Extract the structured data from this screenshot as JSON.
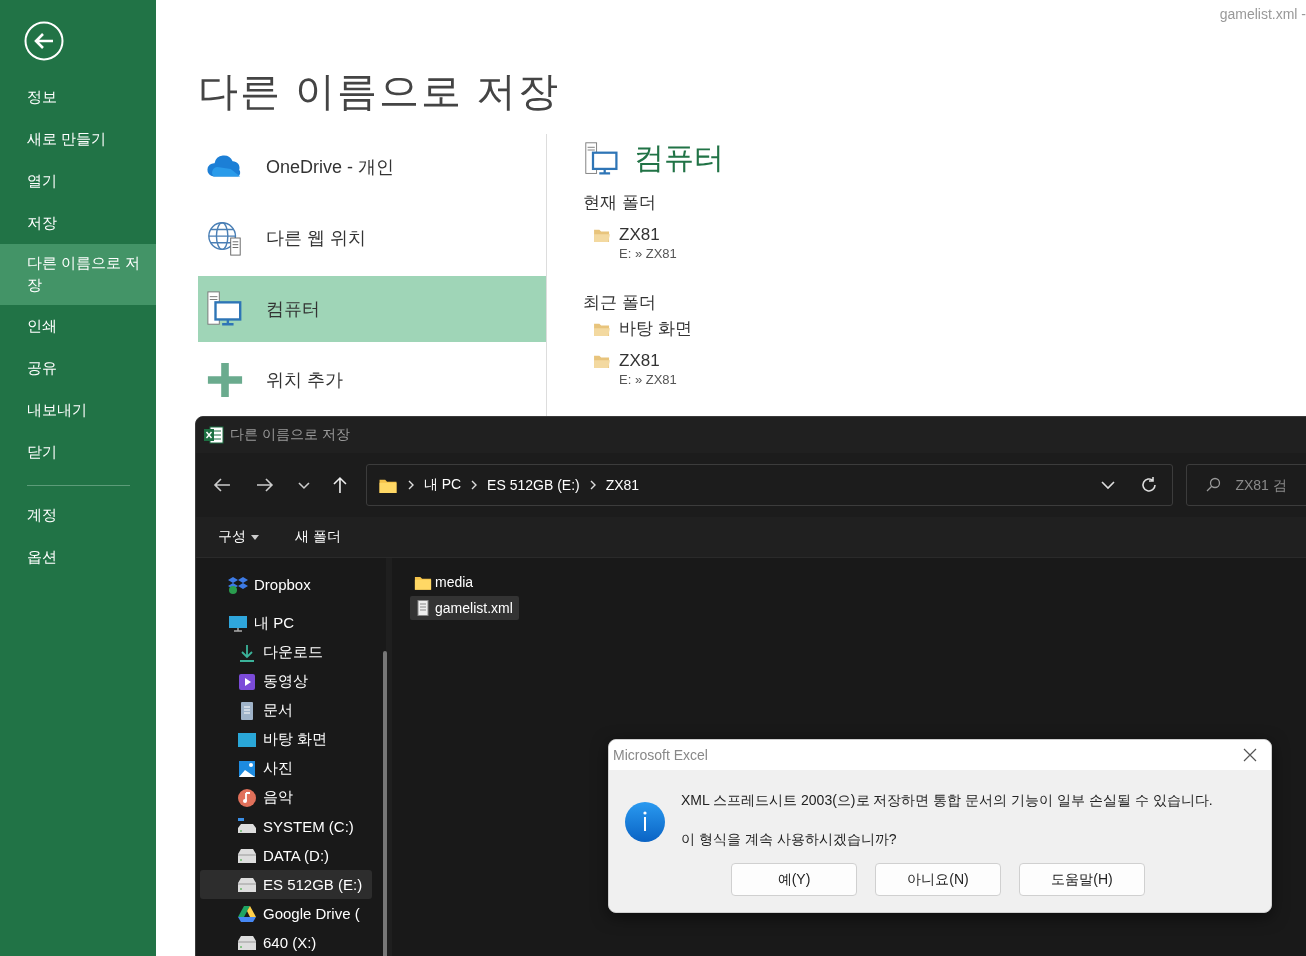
{
  "backstage": {
    "document_title": "gamelist.xml -",
    "nav": [
      {
        "label": "정보",
        "selected": false
      },
      {
        "label": "새로 만들기",
        "selected": false
      },
      {
        "label": "열기",
        "selected": false
      },
      {
        "label": "저장",
        "selected": false
      },
      {
        "label": "다른 이름으로 저장",
        "selected": true
      },
      {
        "label": "인쇄",
        "selected": false
      },
      {
        "label": "공유",
        "selected": false
      },
      {
        "label": "내보내기",
        "selected": false
      },
      {
        "label": "닫기",
        "selected": false
      }
    ],
    "nav_bottom": [
      {
        "label": "계정",
        "selected": false
      },
      {
        "label": "옵션",
        "selected": false
      }
    ],
    "title": "다른 이름으로 저장",
    "locations": [
      {
        "kind": "onedrive",
        "label": "OneDrive - 개인",
        "selected": false
      },
      {
        "kind": "web",
        "label": "다른 웹 위치",
        "selected": false
      },
      {
        "kind": "computer",
        "label": "컴퓨터",
        "selected": true
      },
      {
        "kind": "add",
        "label": "위치 추가",
        "selected": false
      }
    ],
    "panel": {
      "title": "컴퓨터",
      "current_heading": "현재 폴더",
      "current": [
        {
          "name": "ZX81",
          "path": "E: » ZX81"
        }
      ],
      "recent_heading": "최근 폴더",
      "recent": [
        {
          "name": "바탕 화면"
        },
        {
          "name": "ZX81",
          "path": "E: » ZX81"
        }
      ]
    }
  },
  "save_dialog": {
    "title": "다른 이름으로 저장",
    "breadcrumb": [
      "내 PC",
      "ES 512GB (E:)",
      "ZX81"
    ],
    "search": {
      "placeholder": "ZX81 검"
    },
    "toolbar": [
      {
        "label": "구성",
        "dropdown": true
      },
      {
        "label": "새 폴더",
        "dropdown": false
      }
    ],
    "nav_items": [
      {
        "kind": "dropbox",
        "label": "Dropbox",
        "selected": false
      },
      {
        "kind": "pc",
        "label": "내 PC",
        "selected": false,
        "children": [
          {
            "kind": "download",
            "label": "다운로드",
            "selected": false
          },
          {
            "kind": "video",
            "label": "동영상",
            "selected": false
          },
          {
            "kind": "document",
            "label": "문서",
            "selected": false
          },
          {
            "kind": "desktop",
            "label": "바탕 화면",
            "selected": false
          },
          {
            "kind": "photo",
            "label": "사진",
            "selected": false
          },
          {
            "kind": "music",
            "label": "음악",
            "selected": false
          },
          {
            "kind": "systemdrive",
            "label": "SYSTEM (C:)",
            "selected": false
          },
          {
            "kind": "drive",
            "label": "DATA (D:)",
            "selected": false
          },
          {
            "kind": "drive",
            "label": "ES 512GB (E:)",
            "selected": true
          },
          {
            "kind": "gdrive",
            "label": "Google Drive (",
            "selected": false
          },
          {
            "kind": "drive",
            "label": "640 (X:)",
            "selected": false
          }
        ]
      }
    ],
    "files": [
      {
        "kind": "folder",
        "name": "media",
        "selected": false
      },
      {
        "kind": "file",
        "name": "gamelist.xml",
        "selected": true
      }
    ]
  },
  "message_box": {
    "title": "Microsoft Excel",
    "message": "XML 스프레드시트 2003(으)로 저장하면 통합 문서의 기능이 일부 손실될 수 있습니다.",
    "question": "이 형식을 계속 사용하시겠습니까?",
    "buttons": [
      "예(Y)",
      "아니요(N)",
      "도움말(H)"
    ]
  }
}
